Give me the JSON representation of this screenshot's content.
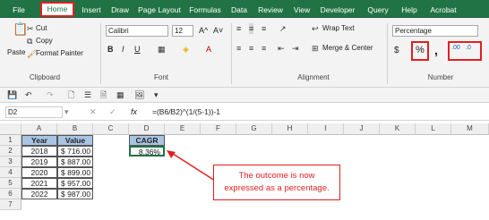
{
  "tabs": [
    "File",
    "Home",
    "Insert",
    "Draw",
    "Page Layout",
    "Formulas",
    "Data",
    "Review",
    "View",
    "Developer",
    "Query",
    "Help",
    "Acrobat"
  ],
  "clipboard": {
    "paste": "Paste",
    "cut": "Cut",
    "copy": "Copy",
    "format_painter": "Format Painter",
    "label": "Clipboard"
  },
  "font": {
    "name": "Calibri",
    "size": "12",
    "label": "Font",
    "bold": "B",
    "italic": "I",
    "underline": "U",
    "grow": "A^",
    "shrink": "A˅"
  },
  "alignment": {
    "wrap": "Wrap Text",
    "merge": "Merge & Center",
    "label": "Alignment"
  },
  "number": {
    "format": "Percentage",
    "currency": "$",
    "percent": "%",
    "comma": ",",
    "inc_decimal": "←.0\n.00",
    "dec_decimal": ".00\n→.0",
    "label": "Number"
  },
  "formula_bar": {
    "name_box": "D2",
    "fx": "fx",
    "formula": "=(B6/B2)^(1/(5-1))-1"
  },
  "columns": [
    "A",
    "B",
    "C",
    "D",
    "E",
    "F",
    "G",
    "H",
    "I",
    "J",
    "K",
    "L",
    "M"
  ],
  "rows": [
    "1",
    "2",
    "3",
    "4",
    "5",
    "6",
    "7"
  ],
  "table": {
    "headers": [
      "Year",
      "Value"
    ],
    "rows": [
      [
        "2018",
        "$ 716.00"
      ],
      [
        "2019",
        "$ 887.00"
      ],
      [
        "2020",
        "$ 899.00"
      ],
      [
        "2021",
        "$ 957.00"
      ],
      [
        "2022",
        "$ 987.00"
      ]
    ]
  },
  "cagr": {
    "header": "CAGR",
    "value": "8.36%"
  },
  "callout": {
    "line1": "The outcome is now",
    "line2": "expressed as a percentage."
  },
  "colors": {
    "excel_green": "#217346",
    "highlight_red": "#e02020",
    "header_blue": "#a9c4e4"
  }
}
